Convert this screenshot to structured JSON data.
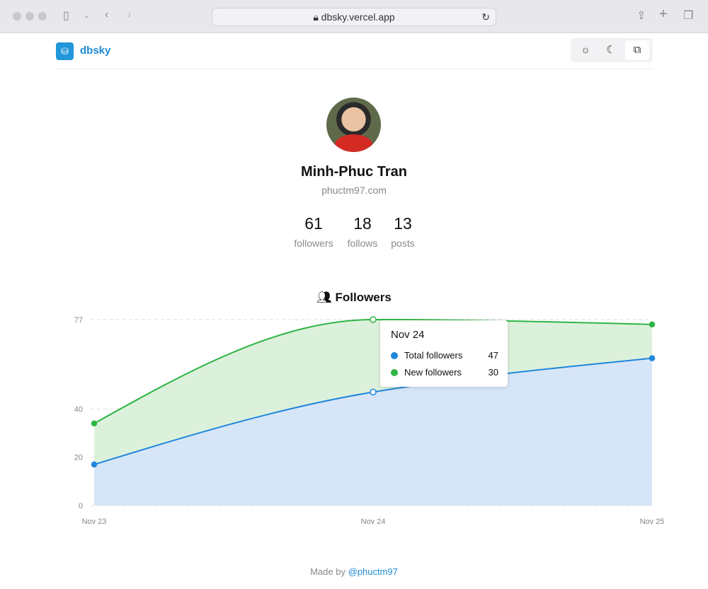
{
  "browser": {
    "url": "dbsky.vercel.app"
  },
  "header": {
    "brand": "dbsky",
    "theme_options": [
      "light",
      "dark",
      "system"
    ]
  },
  "profile": {
    "name": "Minh-Phuc Tran",
    "handle": "phuctm97.com",
    "stats": [
      {
        "value": "61",
        "label": "followers"
      },
      {
        "value": "18",
        "label": "follows"
      },
      {
        "value": "13",
        "label": "posts"
      }
    ]
  },
  "chart_data": {
    "type": "area",
    "title": "Followers",
    "stacked": true,
    "categories": [
      "Nov 23",
      "Nov 24",
      "Nov 25"
    ],
    "series": [
      {
        "name": "Total followers",
        "values": [
          17,
          47,
          61
        ],
        "color": "#1f86dd"
      },
      {
        "name": "New followers",
        "values": [
          17,
          30,
          14
        ],
        "color": "#2fb545"
      }
    ],
    "yticks": [
      0,
      20,
      40,
      77
    ],
    "ylim": [
      0,
      77
    ],
    "grid": true,
    "tooltip": {
      "date": "Nov 24",
      "rows": [
        {
          "label": "Total followers",
          "value": "47"
        },
        {
          "label": "New followers",
          "value": "30"
        }
      ]
    }
  },
  "footer": {
    "prefix": "Made by",
    "link": "@phuctm97"
  }
}
